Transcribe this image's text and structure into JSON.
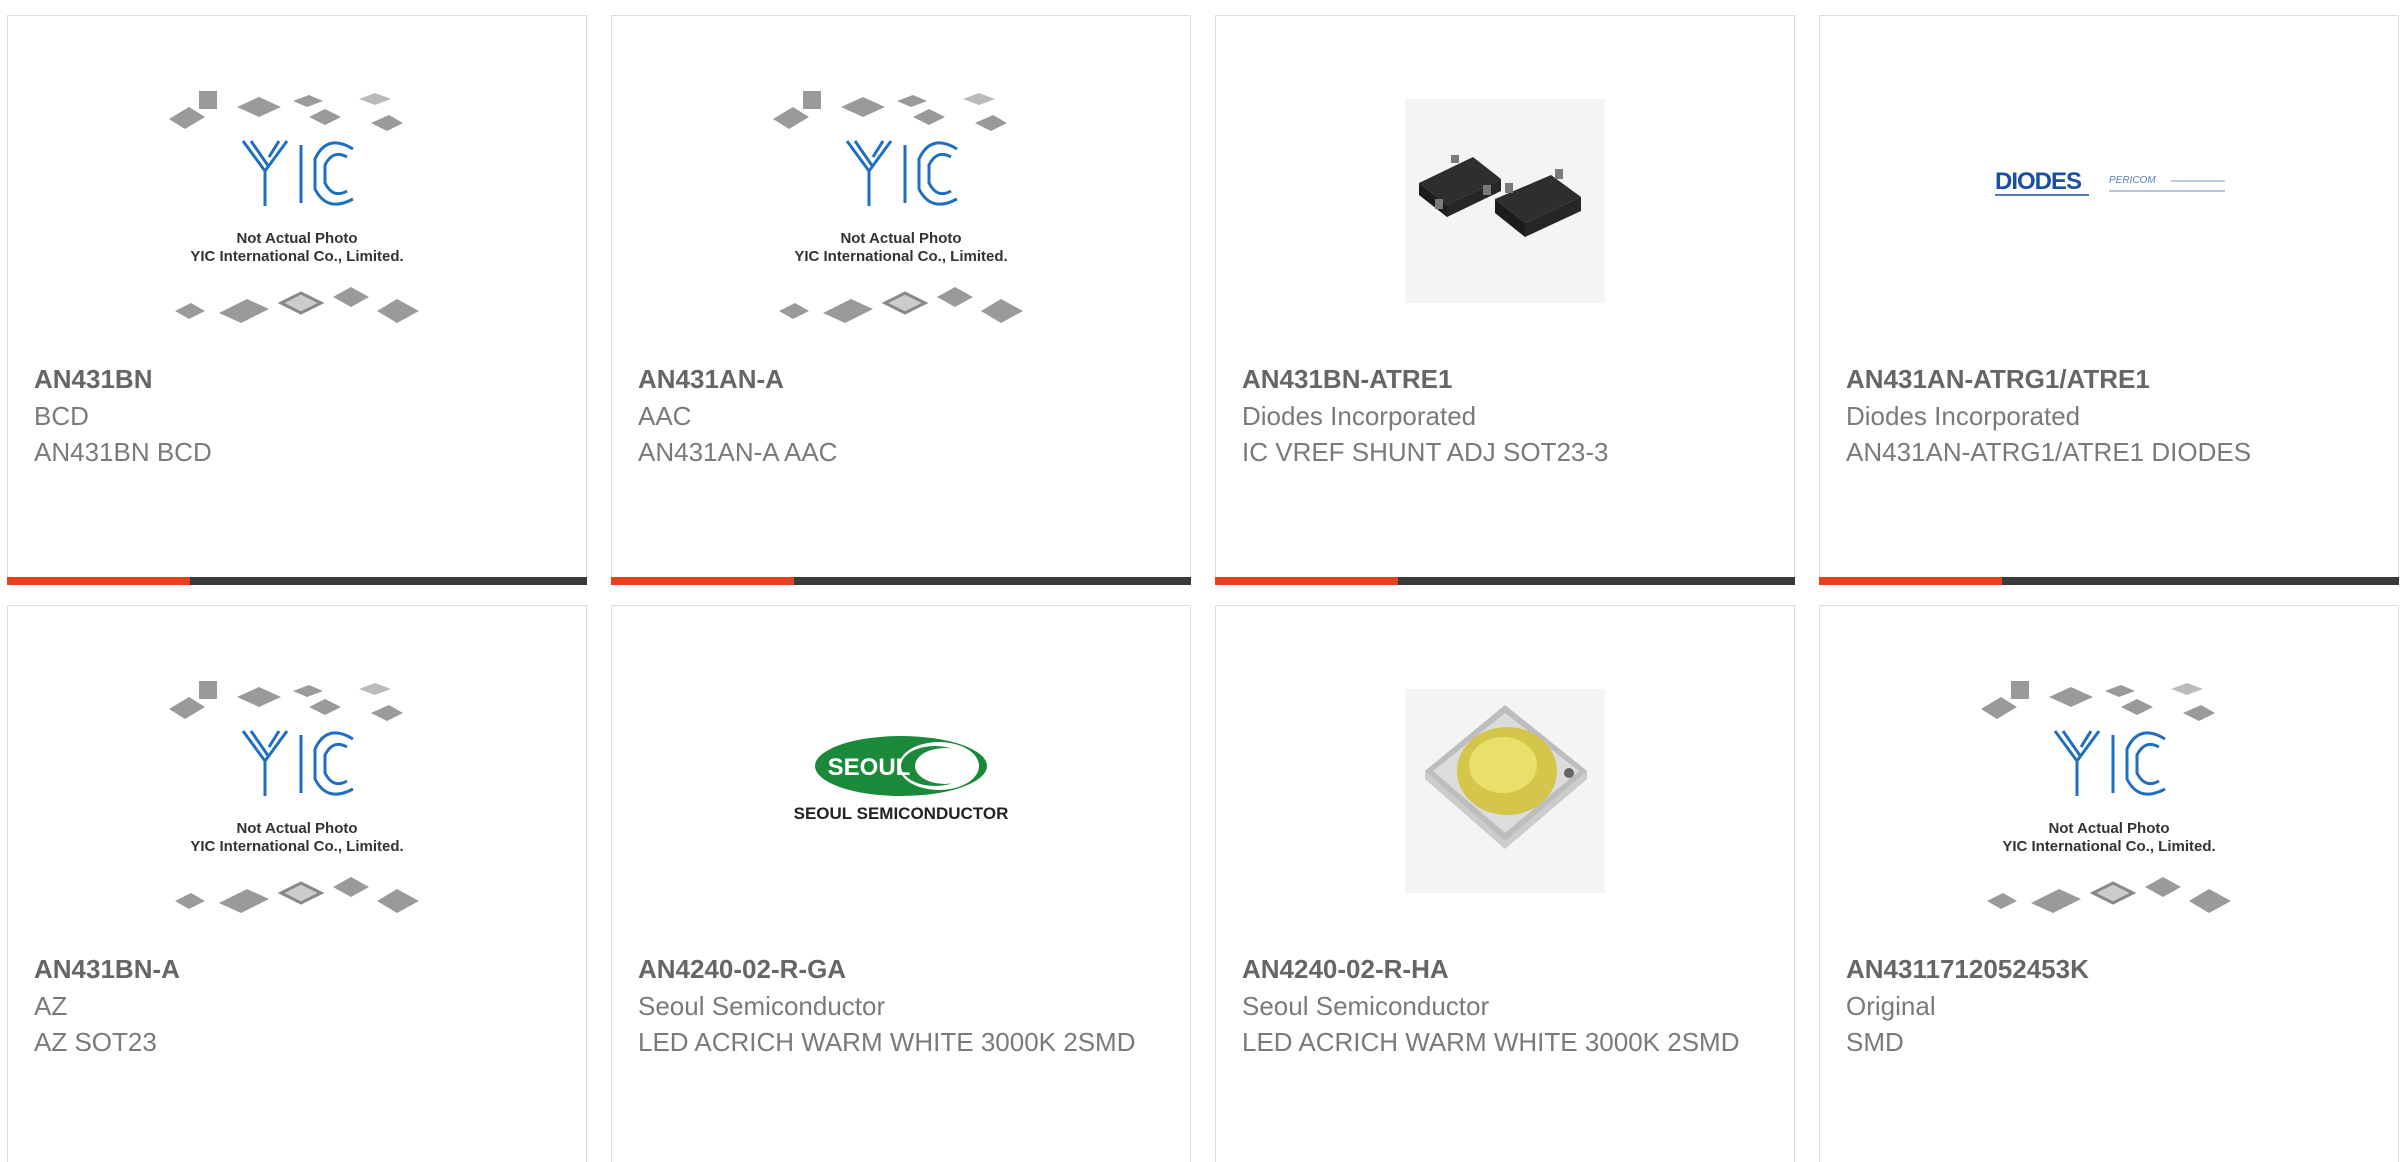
{
  "colors": {
    "accent": "#e8401c",
    "bar": "#3a3a3a",
    "yic_blue": "#1f6fbf",
    "seoul_green": "#1a8a3a",
    "diodes_blue": "#1b4fa0"
  },
  "products": [
    {
      "part_number": "AN431BN",
      "manufacturer": "BCD",
      "description": "AN431BN BCD",
      "image": "yic-placeholder",
      "placeholder_line1": "Not Actual Photo",
      "placeholder_line2": "YIC International Co., Limited."
    },
    {
      "part_number": "AN431AN-A",
      "manufacturer": "AAC",
      "description": "AN431AN-A AAC",
      "image": "yic-placeholder",
      "placeholder_line1": "Not Actual Photo",
      "placeholder_line2": "YIC International Co., Limited."
    },
    {
      "part_number": "AN431BN-ATRE1",
      "manufacturer": "Diodes Incorporated",
      "description": "IC VREF SHUNT ADJ SOT23-3",
      "image": "sot23-photo"
    },
    {
      "part_number": "AN431AN-ATRG1/ATRE1",
      "manufacturer": "Diodes Incorporated",
      "description": "AN431AN-ATRG1/ATRE1 DIODES",
      "image": "diodes-logo",
      "logo_text": "DIODES",
      "logo_sub": "PERICOM"
    },
    {
      "part_number": "AN431BN-A",
      "manufacturer": "AZ",
      "description": "AZ SOT23",
      "image": "yic-placeholder",
      "placeholder_line1": "Not Actual Photo",
      "placeholder_line2": "YIC International Co., Limited."
    },
    {
      "part_number": "AN4240-02-R-GA",
      "manufacturer": "Seoul Semiconductor",
      "description": "LED ACRICH WARM WHITE 3000K 2SMD",
      "image": "seoul-logo",
      "logo_text": "SEOUL",
      "logo_sub": "SEOUL SEMICONDUCTOR"
    },
    {
      "part_number": "AN4240-02-R-HA",
      "manufacturer": "Seoul Semiconductor",
      "description": "LED ACRICH WARM WHITE 3000K 2SMD",
      "image": "led-photo"
    },
    {
      "part_number": "AN4311712052453K",
      "manufacturer": "Original",
      "description": "SMD",
      "image": "yic-placeholder",
      "placeholder_line1": "Not Actual Photo",
      "placeholder_line2": "YIC International Co., Limited."
    }
  ]
}
